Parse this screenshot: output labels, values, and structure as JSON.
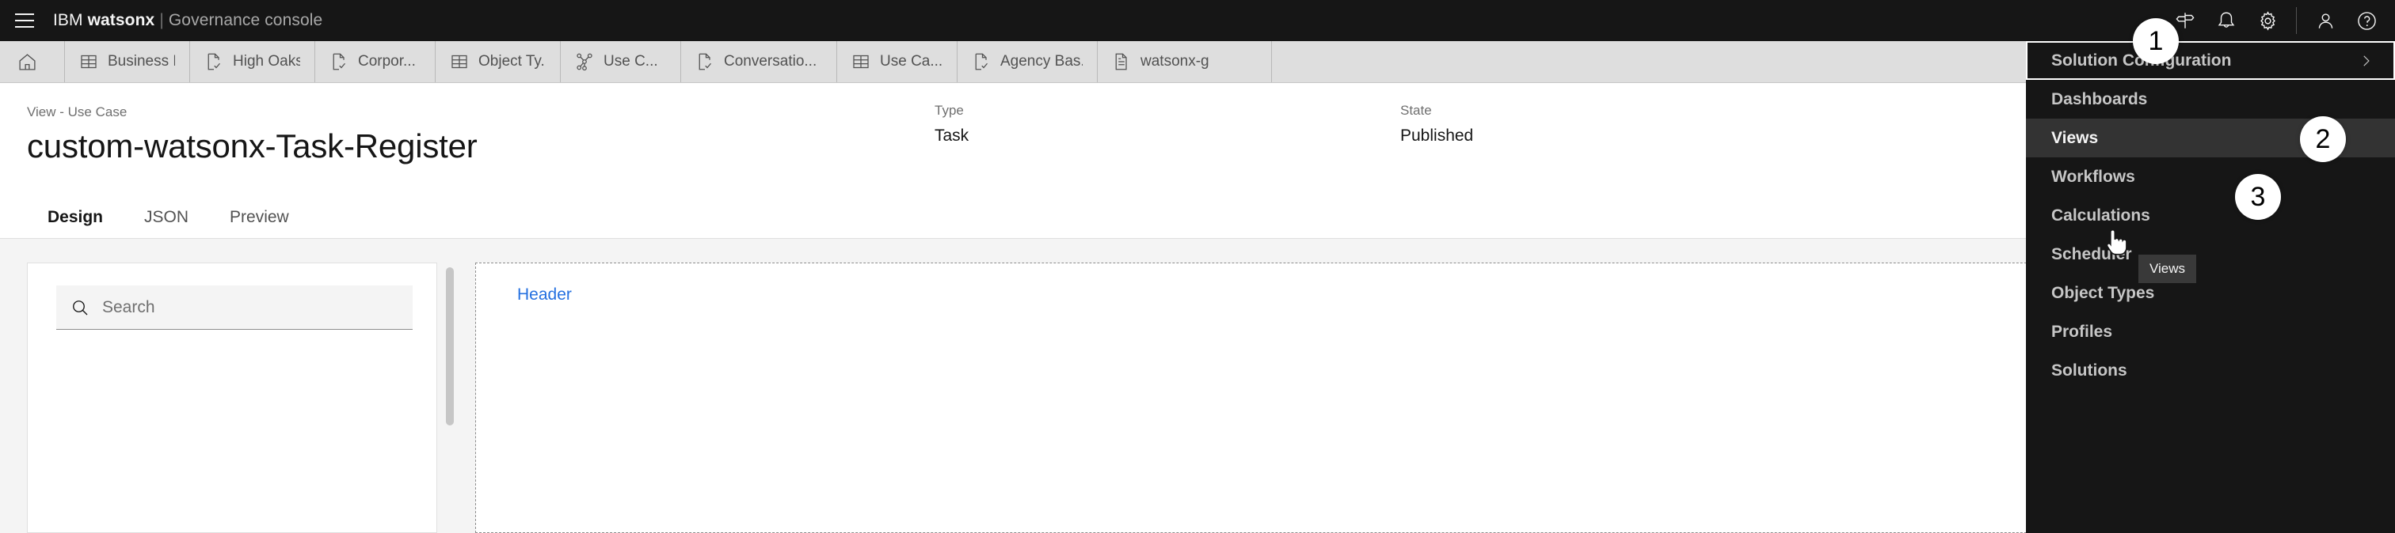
{
  "topbar": {
    "menu_icon": "hamburger-icon",
    "brand_ibm": "IBM",
    "brand_product": "watsonx",
    "brand_separator": "|",
    "brand_subtitle": "Governance console",
    "icons": [
      {
        "name": "signpost-icon",
        "label": "Signpost"
      },
      {
        "name": "notification-bell-icon",
        "label": "Notifications"
      },
      {
        "name": "gear-icon",
        "label": "Settings"
      },
      {
        "name": "user-avatar-icon",
        "label": "Account"
      },
      {
        "name": "help-icon",
        "label": "Help"
      }
    ]
  },
  "tabstrip": {
    "home_label": "Home",
    "tabs": [
      {
        "label": "Business E...",
        "icon": "table-icon"
      },
      {
        "label": "High Oaks ...",
        "icon": "document-check-icon"
      },
      {
        "label": "Corpor...",
        "icon": "document-check-icon"
      },
      {
        "label": "Object Ty...",
        "icon": "table-icon"
      },
      {
        "label": "Use C...",
        "icon": "network-graph-icon"
      },
      {
        "label": "Conversatio...",
        "icon": "document-check-icon"
      },
      {
        "label": "Use Ca...",
        "icon": "table-icon"
      },
      {
        "label": "Agency Bas...",
        "icon": "document-check-icon"
      },
      {
        "label": "watsonx-g",
        "icon": "document-icon"
      }
    ]
  },
  "page": {
    "eyebrow": "View - Use Case",
    "title": "custom-watsonx-Task-Register",
    "meta": {
      "type_label": "Type",
      "type_value": "Task",
      "state_label": "State",
      "state_value": "Published"
    },
    "subtabs": [
      {
        "label": "Design",
        "active": true
      },
      {
        "label": "JSON",
        "active": false
      },
      {
        "label": "Preview",
        "active": false
      }
    ]
  },
  "designer": {
    "search_placeholder": "Search",
    "search_value": "",
    "canvas_header_label": "Header"
  },
  "flyout": {
    "items": [
      {
        "label": "Solution Configuration",
        "state": "focused",
        "has_chevron": true
      },
      {
        "label": "Dashboards",
        "state": "normal",
        "has_chevron": false
      },
      {
        "label": "Views",
        "state": "hovered",
        "has_chevron": false
      },
      {
        "label": "Workflows",
        "state": "normal",
        "has_chevron": false
      },
      {
        "label": "Calculations",
        "state": "normal",
        "has_chevron": false
      },
      {
        "label": "Scheduler",
        "state": "normal",
        "has_chevron": false
      },
      {
        "label": "Object Types",
        "state": "normal",
        "has_chevron": false
      },
      {
        "label": "Profiles",
        "state": "normal",
        "has_chevron": false
      },
      {
        "label": "Solutions",
        "state": "normal",
        "has_chevron": false
      }
    ],
    "tooltip": "Views"
  },
  "annotations": {
    "badge_1": "1",
    "badge_2": "2",
    "badge_3": "3"
  },
  "colors": {
    "header_bg": "#161616",
    "tabstrip_bg": "#dedede",
    "accent_blue": "#0f62fe",
    "link_blue": "#2470e0",
    "canvas_bg": "#f4f4f4"
  }
}
